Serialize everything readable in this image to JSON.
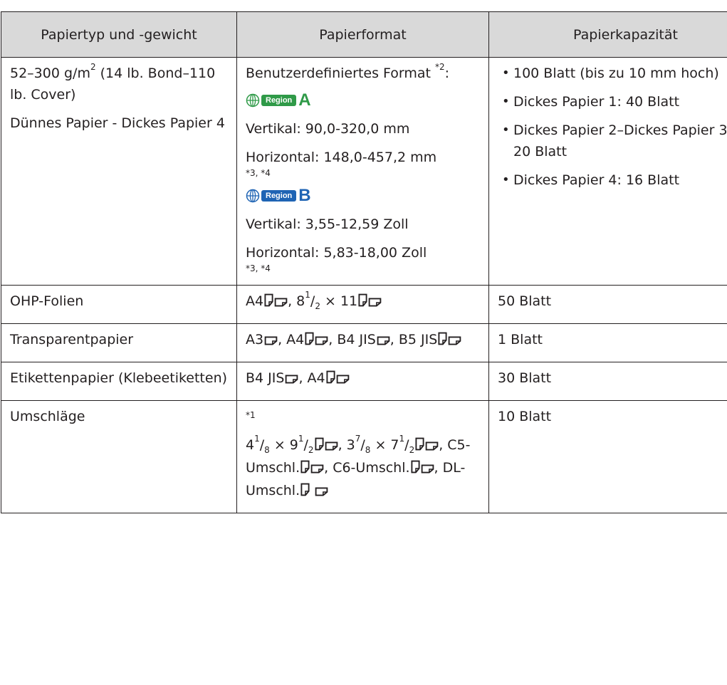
{
  "headers": [
    "Papiertyp und -gewicht",
    "Papierformat",
    "Papierkapazität"
  ],
  "colors": {
    "header_bg": "#d9d9d9",
    "border": "#231f20",
    "region_a": "#2f9a48",
    "region_b": "#1f64b4"
  },
  "row1": {
    "type_line1_a": "52–300 g/m",
    "type_line1_sup": "2",
    "type_line1_b": " (14 lb. Bond–110 lb. Cover)",
    "type_line2": "Dünnes Papier - Dickes Papier 4",
    "format_intro": "Benutzerdefiniertes Format ",
    "format_intro_sup": "*2",
    "format_intro_colon": ":",
    "region_a_pill": "Region",
    "region_a_letter": "A",
    "region_a_vertical": "Vertikal: 90,0-320,0 mm",
    "region_a_horizontal": "Horizontal: 148,0-457,2 mm",
    "region_a_footnote": "*3, *4",
    "region_b_pill": "Region",
    "region_b_letter": "B",
    "region_b_vertical": "Vertikal: 3,55-12,59 Zoll",
    "region_b_horizontal": "Horizontal: 5,83-18,00 Zoll",
    "region_b_footnote": "*3, *4",
    "capacity": [
      "100 Blatt (bis zu 10 mm hoch)",
      "Dickes Papier 1: 40 Blatt",
      "Dickes Papier 2–Dickes Papier 3: 20 Blatt",
      "Dickes Papier 4: 16 Blatt"
    ]
  },
  "row2": {
    "type": "OHP-Folien",
    "fmt_a": "A4",
    "fmt_b": ", 8",
    "fmt_sup": "1",
    "fmt_slash": "/",
    "fmt_sub": "2",
    "fmt_c": " × 11",
    "capacity": "50 Blatt"
  },
  "row3": {
    "type": "Transparentpapier",
    "fmt_a": "A3",
    "fmt_b": ", A4",
    "fmt_c": ", B4 JIS",
    "fmt_d": ", B5 JIS",
    "capacity": "1 Blatt"
  },
  "row4": {
    "type": "Etikettenpapier (Klebeetiketten)",
    "fmt_a": "B4 JIS",
    "fmt_b": ", A4",
    "capacity": "30 Blatt"
  },
  "row5": {
    "type": "Umschläge",
    "footnote": "*1",
    "f1_a": "4",
    "f1_sup": "1",
    "f1_slash": "/",
    "f1_sub": "8",
    "f1_b": " × 9",
    "f1_sup2": "1",
    "f1_slash2": "/",
    "f1_sub2": "2",
    "f2_a": ", 3",
    "f2_sup": "7",
    "f2_slash": "/",
    "f2_sub": "8",
    "f2_b": " × 7",
    "f2_sup2": "1",
    "f2_slash2": "/",
    "f2_sub2": "2",
    "f3": ", C5-Umschl.",
    "f4": ", C6-Umschl.",
    "f5": ", DL-Umschl.",
    "capacity": "10 Blatt"
  }
}
